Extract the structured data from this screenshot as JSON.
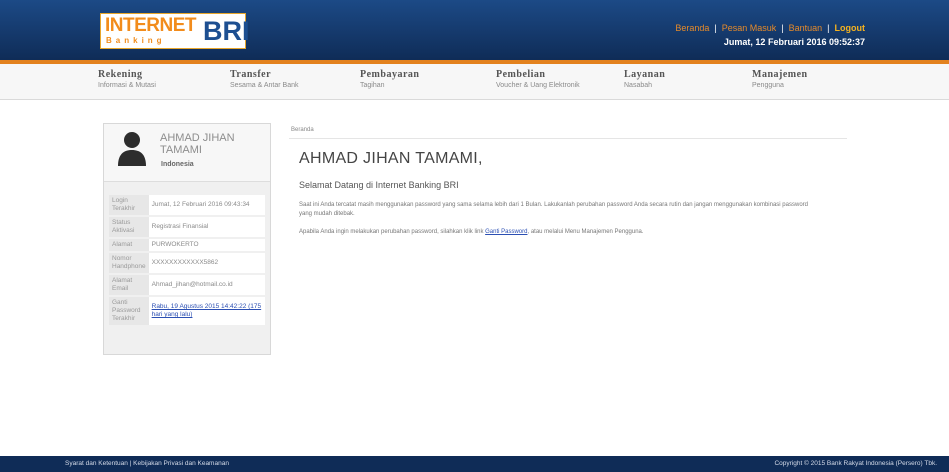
{
  "header": {
    "logo_internet": "INTERNET",
    "logo_banking": "Banking",
    "logo_bri": "BRI",
    "links": {
      "beranda": "Beranda",
      "pesan_masuk": "Pesan Masuk",
      "bantuan": "Bantuan",
      "logout": "Logout"
    },
    "separator": "|",
    "datetime": "Jumat, 12 Februari 2016 09:52:37"
  },
  "nav": [
    {
      "title": "Rekening",
      "sub": "Informasi & Mutasi"
    },
    {
      "title": "Transfer",
      "sub": "Sesama & Antar Bank"
    },
    {
      "title": "Pembayaran",
      "sub": "Tagihan"
    },
    {
      "title": "Pembelian",
      "sub": "Voucher & Uang Elektronik"
    },
    {
      "title": "Layanan",
      "sub": "Nasabah"
    },
    {
      "title": "Manajemen",
      "sub": "Pengguna"
    }
  ],
  "profile": {
    "name": "AHMAD JIHAN TAMAMI",
    "country": "Indonesia",
    "rows": [
      {
        "key": "Login Terakhir",
        "value": "Jumat, 12 Februari 2016 09:43:34"
      },
      {
        "key": "Status Aktivasi",
        "value": "Registrasi Finansial"
      },
      {
        "key": "Alamat",
        "value": "PURWOKERTO"
      },
      {
        "key": "Nomor Handphone",
        "value": "XXXXXXXXXXXX5862"
      },
      {
        "key": "Alamat Email",
        "value": "Ahmad_jihan@hotmail.co.id"
      },
      {
        "key": "Ganti Password Terakhir",
        "value": "Rabu, 19 Agustus 2015 14:42:22 (175 hari yang lalu)"
      }
    ]
  },
  "main": {
    "breadcrumb": "Beranda",
    "greeting": "AHMAD JIHAN TAMAMI,",
    "welcome": "Selamat Datang di Internet Banking BRI",
    "paragraph1": "Saat ini Anda tercatat masih menggunakan password yang sama selama lebih dari 1 Bulan. Lakukanlah perubahan password Anda secara rutin dan jangan menggunakan kombinasi password yang mudah ditebak.",
    "paragraph2_before": "Apabila Anda ingin melakukan perubahan password, silahkan klik link ",
    "paragraph2_link": "Ganti Password",
    "paragraph2_after": ", atau melalui Menu Manajemen Pengguna."
  },
  "footer": {
    "left": "Syarat dan Ketentuan | Kebijakan Privasi dan Keamanan",
    "right": "Copyright © 2015 Bank Rakyat Indonesia (Persero) Tbk."
  },
  "colors": {
    "header_bg": "#15396c",
    "accent_orange": "#e3821e",
    "link_blue": "#2b4fb3"
  }
}
